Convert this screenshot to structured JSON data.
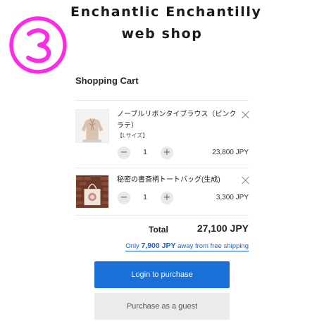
{
  "step": {
    "marker": "③",
    "color": "#ff2ae8"
  },
  "header": {
    "title_line1": "Enchantlic Enchantilly",
    "title_line2": "web shop"
  },
  "cart": {
    "heading": "Shopping Cart",
    "items": [
      {
        "name": "ノーブルリボンタイブラウス（ピンクラテ）",
        "variant": "【Lサイズ】",
        "quantity": "1",
        "price": "23,800 JPY",
        "image": "pink-ribbon-blouse-photo",
        "remove_icon": "close-icon"
      },
      {
        "name": "秘密の書斎柄トートバッグ(生成)",
        "variant": "",
        "quantity": "1",
        "price": "3,300 JPY",
        "image": "tote-bag-photo",
        "remove_icon": "close-icon"
      }
    ],
    "minus_symbol": "−",
    "plus_symbol": "+",
    "total_label": "Total",
    "total_value": "27,100 JPY",
    "shipping_prefix": "Only",
    "shipping_amount": "7,900 JPY",
    "shipping_suffix": "away from free shipping"
  },
  "actions": {
    "login_label": "Login to purchase",
    "guest_label": "Purchase as a guest"
  },
  "colors": {
    "accent_blue": "#1b70d8",
    "link_blue": "#1b63c9",
    "guest_button_bg": "#ebebeb"
  }
}
